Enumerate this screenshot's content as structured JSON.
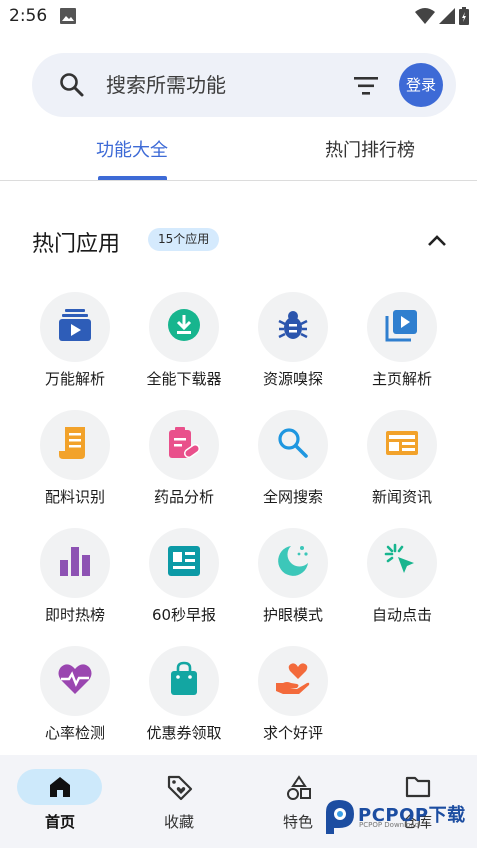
{
  "status": {
    "time": "2:56"
  },
  "search": {
    "placeholder": "搜索所需功能",
    "login_label": "登录"
  },
  "tabs": [
    {
      "label": "功能大全"
    },
    {
      "label": "热门排行榜"
    }
  ],
  "section": {
    "title": "热门应用",
    "badge": "15个应用"
  },
  "apps": [
    {
      "label": "万能解析",
      "icon": "video-stack-icon",
      "color": "#2e5db8"
    },
    {
      "label": "全能下载器",
      "icon": "download-icon",
      "color": "#17b58e"
    },
    {
      "label": "资源嗅探",
      "icon": "bug-icon",
      "color": "#2b55ad"
    },
    {
      "label": "主页解析",
      "icon": "video-library-icon",
      "color": "#2f7fcf"
    },
    {
      "label": "配料识别",
      "icon": "receipt-icon",
      "color": "#f2a22a"
    },
    {
      "label": "药品分析",
      "icon": "medicine-icon",
      "color": "#e9508b"
    },
    {
      "label": "全网搜索",
      "icon": "search-icon",
      "color": "#1f97e0"
    },
    {
      "label": "新闻资讯",
      "icon": "newspaper-icon",
      "color": "#f2a22a"
    },
    {
      "label": "即时热榜",
      "icon": "bar-chart-icon",
      "color": "#8d52b3"
    },
    {
      "label": "60秒早报",
      "icon": "article-icon",
      "color": "#0c9aa6"
    },
    {
      "label": "护眼模式",
      "icon": "moon-icon",
      "color": "#3cc7b9"
    },
    {
      "label": "自动点击",
      "icon": "cursor-click-icon",
      "color": "#17b58e"
    },
    {
      "label": "心率检测",
      "icon": "heart-pulse-icon",
      "color": "#9a46b0"
    },
    {
      "label": "优惠券领取",
      "icon": "shopping-bag-icon",
      "color": "#13a6a2"
    },
    {
      "label": "求个好评",
      "icon": "hand-heart-icon",
      "color": "#f36a3b"
    }
  ],
  "bottom_nav": [
    {
      "label": "首页",
      "icon": "home-icon"
    },
    {
      "label": "收藏",
      "icon": "tag-heart-icon"
    },
    {
      "label": "特色",
      "icon": "shapes-icon"
    },
    {
      "label": "仓库",
      "icon": "folder-icon"
    }
  ],
  "watermark": {
    "text": "PCPOP下载",
    "sub": "PCPOP Download"
  },
  "colors": {
    "accent": "#3d6ad6",
    "search_bg": "#eef1f8",
    "badge_bg": "#d5eafd",
    "nav_pill": "#cde9fb"
  }
}
